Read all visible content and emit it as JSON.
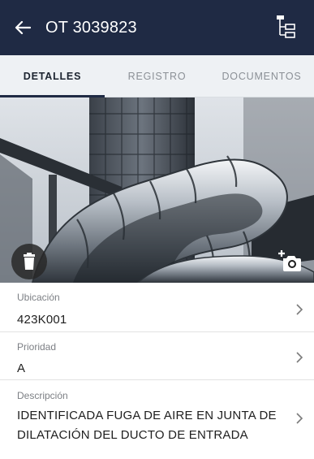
{
  "header": {
    "title": "OT 3039823",
    "back_icon": "arrow-left-icon",
    "tree_icon": "hierarchy-tree-icon",
    "background": "#1f2a44"
  },
  "tabs": [
    {
      "label": "DETALLES",
      "active": true
    },
    {
      "label": "REGISTRO",
      "active": false
    },
    {
      "label": "DOCUMENTOS",
      "active": false
    }
  ],
  "photo": {
    "delete_icon": "trash-icon",
    "add_photo_icon": "add-camera-icon"
  },
  "fields": {
    "location": {
      "label": "Ubicación",
      "value": "423K001"
    },
    "priority": {
      "label": "Prioridad",
      "value": "A"
    },
    "description": {
      "label": "Descripción",
      "value": "IDENTIFICADA FUGA DE AIRE EN JUNTA DE DILATACIÓN DEL DUCTO DE ENTRADA"
    }
  }
}
